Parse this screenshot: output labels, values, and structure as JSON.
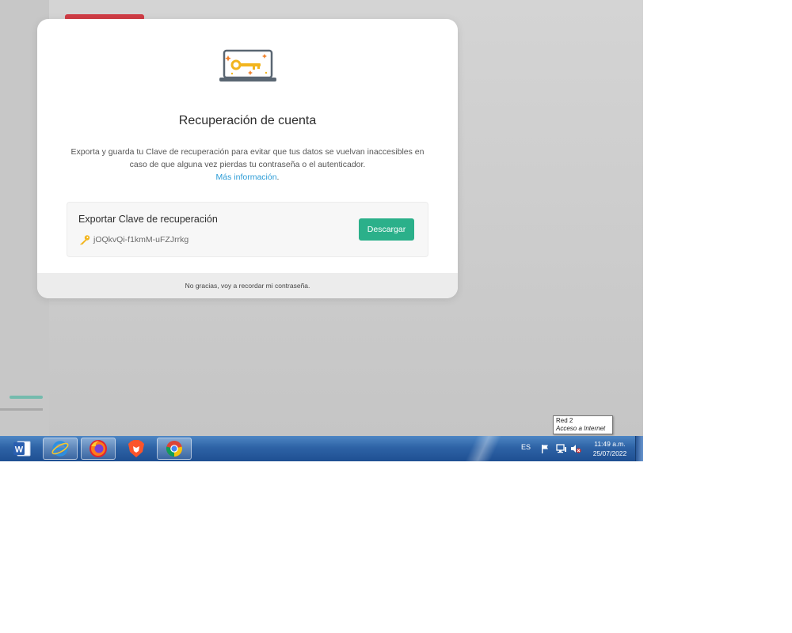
{
  "dialog": {
    "title": "Recuperación de cuenta",
    "description": "Exporta y guarda tu Clave de recuperación para evitar que tus datos se vuelvan inaccesibles en caso de que alguna vez pierdas tu contraseña o el autenticador.",
    "more_info_link": "Más información",
    "more_info_suffix": ".",
    "export_card": {
      "title": "Exportar Clave de recuperación",
      "recovery_key": "jOQkvQi-f1kmM-uFZJrrkg",
      "download_button": "Descargar"
    },
    "footer_link": "No gracias, voy a recordar mi contraseña."
  },
  "tooltip": {
    "line1": "Red  2",
    "line2": "Acceso a Internet"
  },
  "taskbar": {
    "apps": [
      {
        "name": "word",
        "icon": "word-icon"
      },
      {
        "name": "internet-explorer",
        "icon": "internet-explorer-icon"
      },
      {
        "name": "firefox",
        "icon": "firefox-icon"
      },
      {
        "name": "brave",
        "icon": "brave-icon"
      },
      {
        "name": "chrome",
        "icon": "chrome-icon"
      }
    ],
    "language": "ES",
    "time": "11:49 a.m.",
    "date": "25/07/2022"
  },
  "colors": {
    "accent_button": "#2bb08a",
    "link": "#2a9bd6",
    "brand_red": "#cf3c45"
  }
}
